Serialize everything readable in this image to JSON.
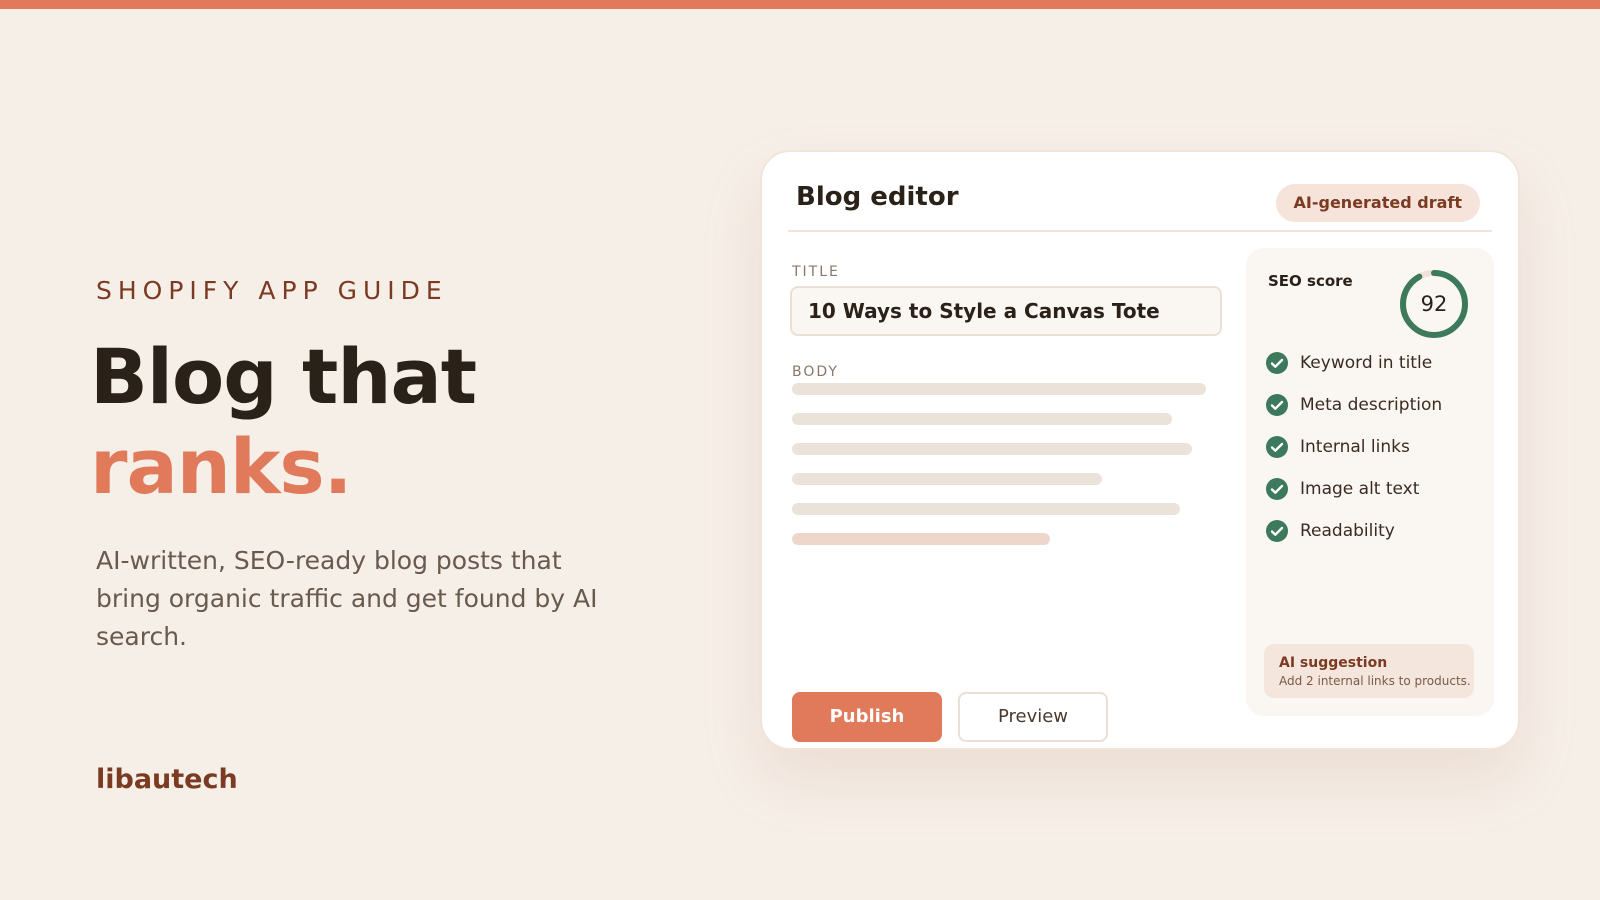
{
  "hero": {
    "eyebrow": "SHOPIFY APP GUIDE",
    "headline_line1": "Blog that",
    "headline_line2": "ranks.",
    "subcopy": "AI-written, SEO-ready blog posts that bring organic traffic and get found by AI search.",
    "brand": "libautech"
  },
  "editor": {
    "title": "Blog editor",
    "badge": "AI-generated draft",
    "title_label": "TITLE",
    "title_value": "10 Ways to Style a Canvas Tote",
    "body_label": "BODY",
    "publish_label": "Publish",
    "preview_label": "Preview"
  },
  "seo": {
    "label": "SEO score",
    "score": "92",
    "score_fraction": 0.92,
    "checks": [
      "Keyword in title",
      "Meta description",
      "Internal links",
      "Image alt text",
      "Readability"
    ],
    "suggestion_title": "AI suggestion",
    "suggestion_text": "Add 2 internal links to products."
  },
  "colors": {
    "accent": "#e07a5a",
    "brand_dark": "#7b3a22",
    "success": "#3d7a5c",
    "background": "#f6efe8"
  },
  "icons": {
    "check": "check-circle-icon"
  }
}
